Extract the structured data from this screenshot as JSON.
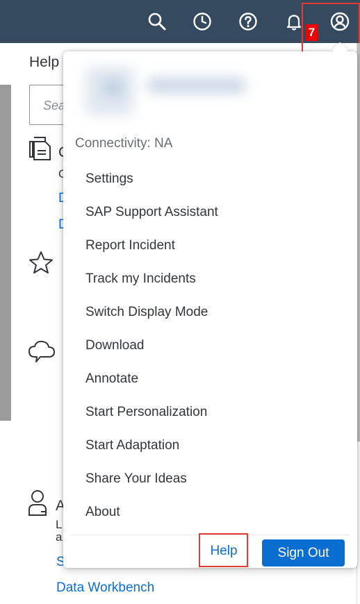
{
  "shell": {
    "notification_count": "7",
    "icons": [
      "search-icon",
      "history-icon",
      "help-icon",
      "bell-icon",
      "user-profile-icon"
    ]
  },
  "background": {
    "title": "Help",
    "search_placeholder": "Sea",
    "section1_initial": "C",
    "section1_sub": "G",
    "link_d1": "D",
    "link_d2": "D",
    "section4_initial": "A",
    "section4_line1": "L",
    "section4_line2": "a",
    "link_s": "S",
    "link_data_workbench": "Data Workbench"
  },
  "user_menu": {
    "connectivity": "Connectivity: NA",
    "items": [
      {
        "label": "Settings"
      },
      {
        "label": "SAP Support Assistant"
      },
      {
        "label": "Report Incident"
      },
      {
        "label": "Track my Incidents"
      },
      {
        "label": "Switch Display Mode"
      },
      {
        "label": "Download"
      },
      {
        "label": "Annotate"
      },
      {
        "label": "Start Personalization"
      },
      {
        "label": "Start Adaptation"
      },
      {
        "label": "Share Your Ideas"
      },
      {
        "label": "About"
      }
    ],
    "help_label": "Help",
    "signout_label": "Sign Out"
  },
  "colors": {
    "shellbar": "#354a5f",
    "accent": "#0a6ed1",
    "highlight": "#e53935",
    "badge": "#ee0000"
  }
}
